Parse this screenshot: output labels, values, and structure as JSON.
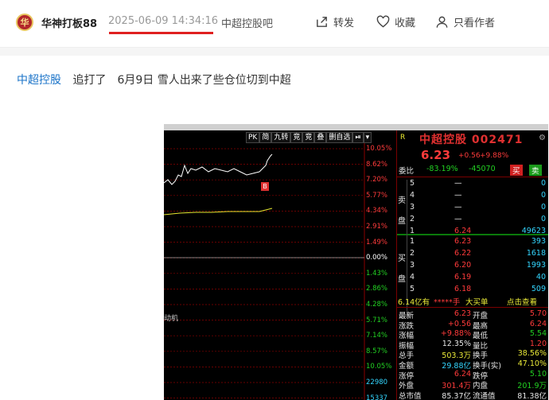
{
  "header": {
    "avatar_text": "华",
    "author": "华神打板88",
    "timestamp": "2025-06-09 14:34:16",
    "bar_name": "中超控股吧",
    "share_label": "转发",
    "favorite_label": "收藏",
    "author_only_label": "只看作者",
    "underline_color": "#e02020"
  },
  "post": {
    "stock_link": "中超控股",
    "text": "追打了　6月9日  雪人出来了些仓位切到中超"
  },
  "terminal": {
    "toolbar": [
      "",
      "",
      "",
      "",
      "",
      "",
      "",
      "",
      "",
      ""
    ],
    "tools": [
      "PK",
      "简",
      "九转",
      "竞",
      "竞",
      "叠",
      "删自选",
      "⏯",
      "▾"
    ],
    "pct_labels": [
      {
        "t": "10.05%",
        "c": "#ff3b3b"
      },
      {
        "t": "8.62%",
        "c": "#ff3b3b"
      },
      {
        "t": "7.20%",
        "c": "#ff3b3b"
      },
      {
        "t": "5.77%",
        "c": "#ff3b3b"
      },
      {
        "t": "4.34%",
        "c": "#ff3b3b"
      },
      {
        "t": "2.91%",
        "c": "#ff3b3b"
      },
      {
        "t": "1.49%",
        "c": "#ff3b3b"
      },
      {
        "t": "0.00%",
        "c": "#ffffff"
      },
      {
        "t": "1.43%",
        "c": "#22d022"
      },
      {
        "t": "2.86%",
        "c": "#22d022"
      },
      {
        "t": "4.28%",
        "c": "#22d022"
      },
      {
        "t": "5.71%",
        "c": "#22d022"
      },
      {
        "t": "7.14%",
        "c": "#22d022"
      },
      {
        "t": "8.57%",
        "c": "#22d022"
      },
      {
        "t": "10.05%",
        "c": "#22d022"
      },
      {
        "t": "22980",
        "c": "#33d6ff"
      },
      {
        "t": "15337",
        "c": "#33d6ff"
      }
    ],
    "left_label": "动机",
    "marker": "B",
    "panel": {
      "r_mark": "R",
      "name": "中超控股 002471",
      "price": "6.23",
      "chg": "+0.56",
      "chg_pct": "+9.88%",
      "webi_label": "委比",
      "webi_val": "-83.19%",
      "webi_diff": "-45070",
      "sell_btn": "买",
      "buy_btn": "卖",
      "sell_label": "卖盘",
      "buy_label": "买盘",
      "asks": [
        {
          "lvl": "5",
          "price": "—",
          "vol": "0"
        },
        {
          "lvl": "4",
          "price": "—",
          "vol": "0"
        },
        {
          "lvl": "3",
          "price": "—",
          "vol": "0"
        },
        {
          "lvl": "2",
          "price": "—",
          "vol": "0"
        },
        {
          "lvl": "1",
          "price": "6.24",
          "vol": "49623"
        }
      ],
      "bids": [
        {
          "lvl": "1",
          "price": "6.23",
          "vol": "393"
        },
        {
          "lvl": "2",
          "price": "6.22",
          "vol": "1618"
        },
        {
          "lvl": "3",
          "price": "6.20",
          "vol": "1993"
        },
        {
          "lvl": "4",
          "price": "6.19",
          "vol": "40"
        },
        {
          "lvl": "5",
          "price": "6.18",
          "vol": "509"
        }
      ],
      "big_order": {
        "a": "6.14亿有",
        "b": "*****手",
        "c": "大买单",
        "d": "点击查看"
      },
      "stats": [
        {
          "l1": "最新",
          "v1": "6.23",
          "c1": "#ff3b3b",
          "l2": "开盘",
          "v2": "5.70",
          "c2": "#ff3b3b"
        },
        {
          "l1": "涨跌",
          "v1": "+0.56",
          "c1": "#ff3b3b",
          "l2": "最高",
          "v2": "6.24",
          "c2": "#ff3b3b"
        },
        {
          "l1": "涨幅",
          "v1": "+9.88%",
          "c1": "#ff3b3b",
          "l2": "最低",
          "v2": "5.54",
          "c2": "#22d022"
        },
        {
          "l1": "振幅",
          "v1": "12.35%",
          "c1": "#e6e6e6",
          "l2": "量比",
          "v2": "1.20",
          "c2": "#ff3b3b"
        },
        {
          "l1": "总手",
          "v1": "503.3万",
          "c1": "#eaea38",
          "l2": "换手",
          "v2": "38.56%",
          "c2": "#eaea38"
        },
        {
          "l1": "金额",
          "v1": "29.88亿",
          "c1": "#33d6ff",
          "l2": "换手(实)",
          "v2": "47.10%",
          "c2": "#eaea38"
        },
        {
          "l1": "涨停",
          "v1": "6.24",
          "c1": "#ff3b3b",
          "l2": "跌停",
          "v2": "5.10",
          "c2": "#22d022"
        },
        {
          "l1": "外盘",
          "v1": "301.4万",
          "c1": "#ff3b3b",
          "l2": "内盘",
          "v2": "201.9万",
          "c2": "#22d022"
        },
        {
          "l1": "总市值",
          "v1": "85.37亿",
          "c1": "#e6e6e6",
          "l2": "流通值",
          "v2": "81.38亿",
          "c2": "#e6e6e6"
        }
      ]
    }
  }
}
